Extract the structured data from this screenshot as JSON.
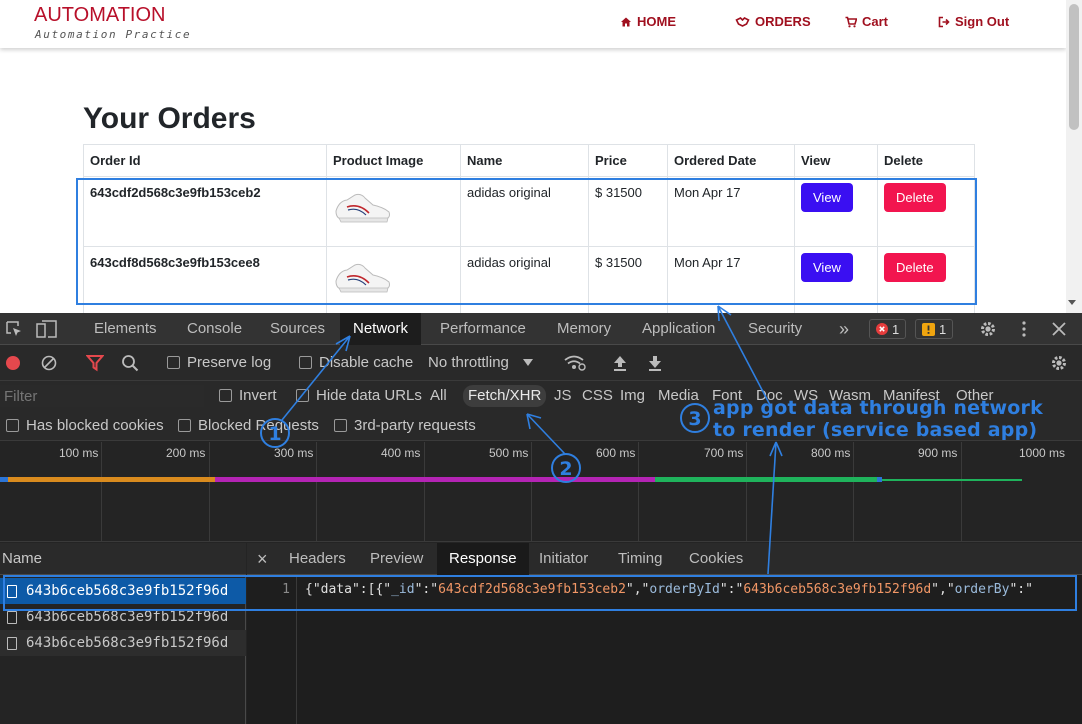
{
  "site": {
    "brand": "AUTOMATION",
    "tagline": "Automation Practice",
    "nav": {
      "home": "HOME",
      "orders": "ORDERS",
      "cart": "Cart",
      "signout": "Sign Out"
    },
    "nav_color": "#a0101f"
  },
  "orders": {
    "title": "Your Orders",
    "columns": [
      "Order Id",
      "Product Image",
      "Name",
      "Price",
      "Ordered Date",
      "View",
      "Delete"
    ],
    "rows": [
      {
        "id": "643cdf2d568c3e9fb153ceb2",
        "name": "adidas original",
        "price": "$ 31500",
        "date": "Mon Apr 17",
        "view": "View",
        "delete": "Delete"
      },
      {
        "id": "643cdf8d568c3e9fb153cee8",
        "name": "adidas original",
        "price": "$ 31500",
        "date": "Mon Apr 17",
        "view": "View",
        "delete": "Delete"
      }
    ],
    "view_color": "#3a0ff2",
    "delete_color": "#f2154f"
  },
  "devtools": {
    "tabs": [
      "Elements",
      "Console",
      "Sources",
      "Network",
      "Performance",
      "Memory",
      "Application",
      "Security"
    ],
    "more": "»",
    "error_count": "1",
    "warning_count": "1",
    "toolbar": {
      "preserve_log": "Preserve log",
      "disable_cache": "Disable cache",
      "throttling": "No throttling"
    },
    "filter": {
      "placeholder": "Filter",
      "invert": "Invert",
      "hide_data_urls": "Hide data URLs",
      "types": [
        "All",
        "Fetch/XHR",
        "JS",
        "CSS",
        "Img",
        "Media",
        "Font",
        "Doc",
        "WS",
        "Wasm",
        "Manifest",
        "Other"
      ],
      "has_blocked_cookies": "Has blocked cookies",
      "blocked_requests": "Blocked Requests",
      "third_party": "3rd-party requests"
    },
    "timeline_labels": [
      "100 ms",
      "200 ms",
      "300 ms",
      "400 ms",
      "500 ms",
      "600 ms",
      "700 ms",
      "800 ms",
      "900 ms",
      "1000 ms"
    ],
    "requests": {
      "header": "Name",
      "items": [
        "643b6ceb568c3e9fb152f96d",
        "643b6ceb568c3e9fb152f96d",
        "643b6ceb568c3e9fb152f96d"
      ]
    },
    "detail_tabs": [
      "Headers",
      "Preview",
      "Response",
      "Initiator",
      "Timing",
      "Cookies"
    ],
    "close": "×",
    "response": {
      "line_number": "1",
      "seg1": "{\"data\":[{\"",
      "key_id": "_id",
      "seg2": "\":\"",
      "val_id": "643cdf2d568c3e9fb153ceb2",
      "seg3": "\",\"",
      "key_orderById": "orderById",
      "seg4": "\":\"",
      "val_orderById": "643b6ceb568c3e9fb152f96d",
      "seg5": "\",\"",
      "key_orderBy": "orderBy",
      "seg6": "\":\""
    }
  },
  "annotations": {
    "num1": "1",
    "num2": "2",
    "num3": "3",
    "note_line1": "app got data through network",
    "note_line2": "to render (service based app)",
    "color": "#2f7fe0"
  }
}
